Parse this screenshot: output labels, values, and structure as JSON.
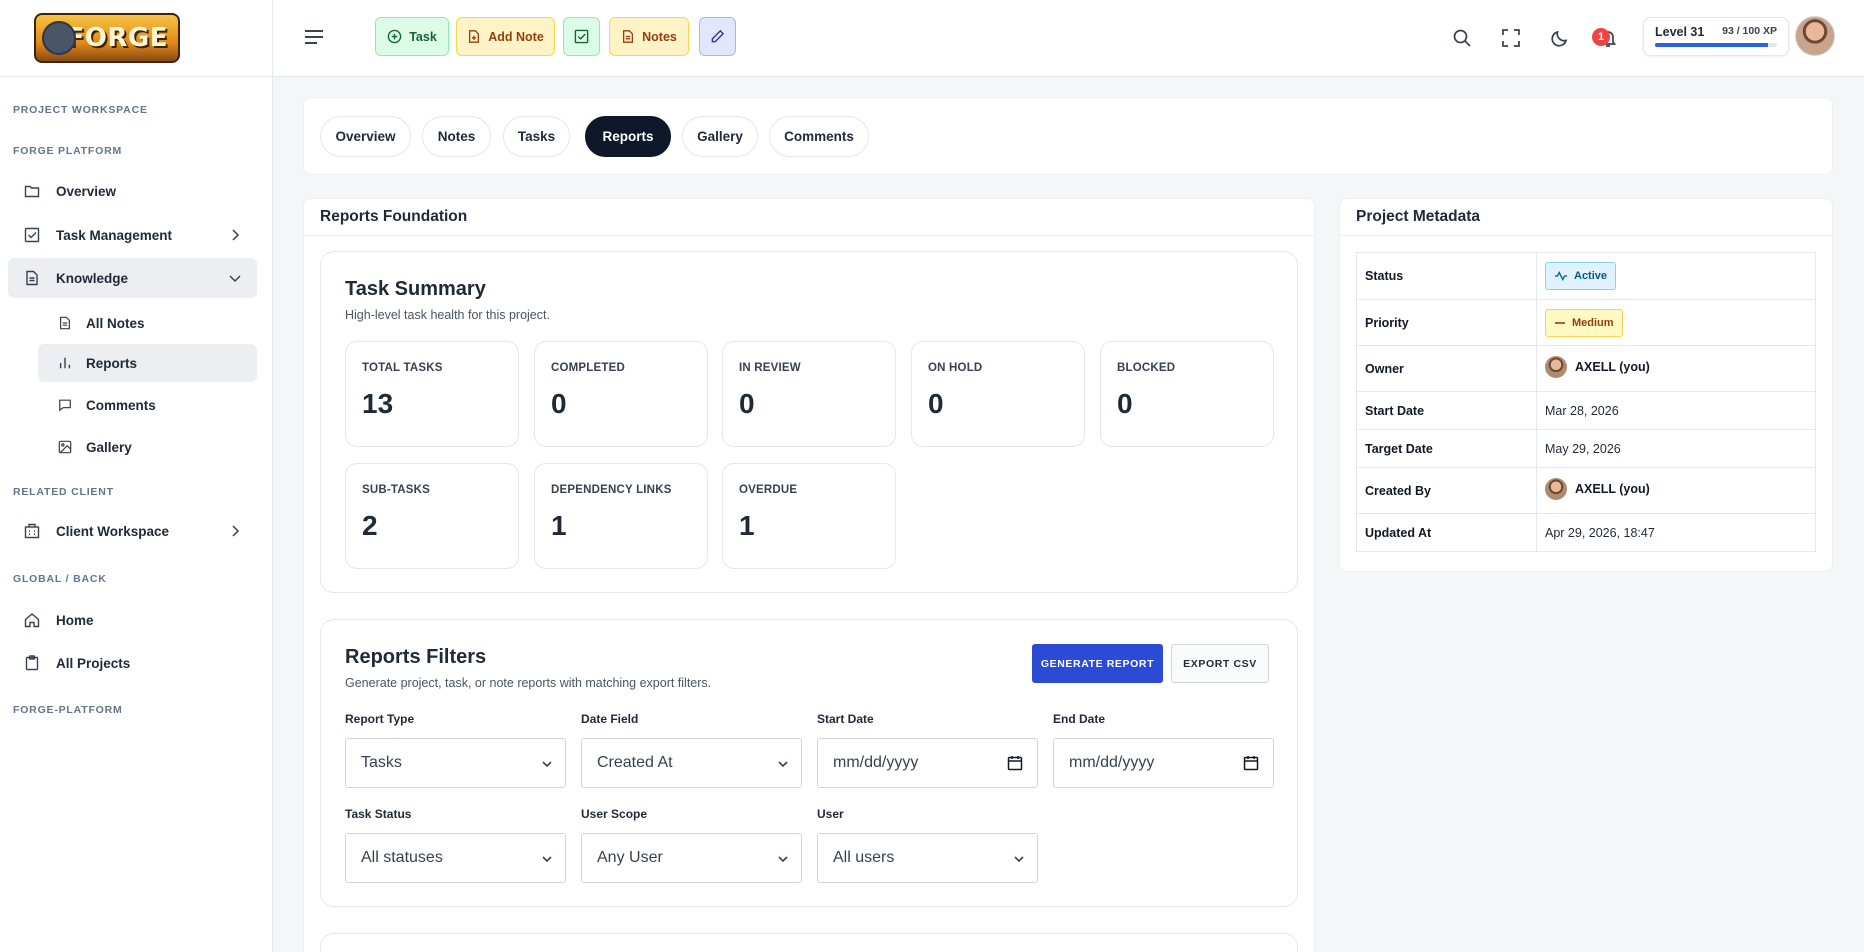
{
  "brand": {
    "logo_text": "FORGE"
  },
  "sidebar": {
    "sections": {
      "project_workspace": "PROJECT WORKSPACE",
      "forge_platform": "FORGE PLATFORM",
      "related_client": "RELATED CLIENT",
      "global_back": "GLOBAL / BACK",
      "forge_platform_lower": "FORGE-PLATFORM"
    },
    "items": {
      "overview": "Overview",
      "task_management": "Task Management",
      "knowledge": "Knowledge",
      "all_notes": "All Notes",
      "reports": "Reports",
      "comments": "Comments",
      "gallery": "Gallery",
      "client_workspace": "Client Workspace",
      "home": "Home",
      "all_projects": "All Projects"
    }
  },
  "topbar": {
    "quick": {
      "task": "Task",
      "add_note": "Add Note",
      "notes": "Notes"
    },
    "notification_count": "1",
    "xp": {
      "level": "Level 31",
      "text": "93 / 100 XP",
      "progress": 0.93
    }
  },
  "tabs": [
    "Overview",
    "Notes",
    "Tasks",
    "Reports",
    "Gallery",
    "Comments"
  ],
  "active_tab": "Reports",
  "foundation": {
    "title": "Reports Foundation",
    "summary": {
      "title": "Task Summary",
      "subtitle": "High-level task health for this project.",
      "stats": [
        {
          "label": "TOTAL TASKS",
          "value": "13"
        },
        {
          "label": "COMPLETED",
          "value": "0"
        },
        {
          "label": "IN REVIEW",
          "value": "0"
        },
        {
          "label": "ON HOLD",
          "value": "0"
        },
        {
          "label": "BLOCKED",
          "value": "0"
        },
        {
          "label": "SUB-TASKS",
          "value": "2"
        },
        {
          "label": "DEPENDENCY LINKS",
          "value": "1"
        },
        {
          "label": "OVERDUE",
          "value": "1"
        }
      ]
    },
    "filters": {
      "title": "Reports Filters",
      "subtitle": "Generate project, task, or note reports with matching export filters.",
      "generate_label": "GENERATE REPORT",
      "export_label": "EXPORT CSV",
      "report_type": {
        "label": "Report Type",
        "value": "Tasks"
      },
      "date_field": {
        "label": "Date Field",
        "value": "Created At"
      },
      "start_date": {
        "label": "Start Date",
        "value": "mm/dd/yyyy"
      },
      "end_date": {
        "label": "End Date",
        "value": "mm/dd/yyyy"
      },
      "task_status": {
        "label": "Task Status",
        "value": "All statuses"
      },
      "user_scope": {
        "label": "User Scope",
        "value": "Any User"
      },
      "user": {
        "label": "User",
        "value": "All users"
      }
    }
  },
  "metadata": {
    "title": "Project Metadata",
    "status_label": "Status",
    "status_value": "Active",
    "priority_label": "Priority",
    "priority_value": "Medium",
    "owner_label": "Owner",
    "owner_value": "AXELL (you)",
    "start_label": "Start Date",
    "start_value": "Mar 28, 2026",
    "target_label": "Target Date",
    "target_value": "May 29, 2026",
    "created_by_label": "Created By",
    "created_by_value": "AXELL (you)",
    "updated_label": "Updated At",
    "updated_value": "Apr 29, 2026, 18:47"
  },
  "colors": {
    "accent": "#2b4ad6",
    "active_tab": "#0f172a",
    "badge": "#ef4444"
  }
}
